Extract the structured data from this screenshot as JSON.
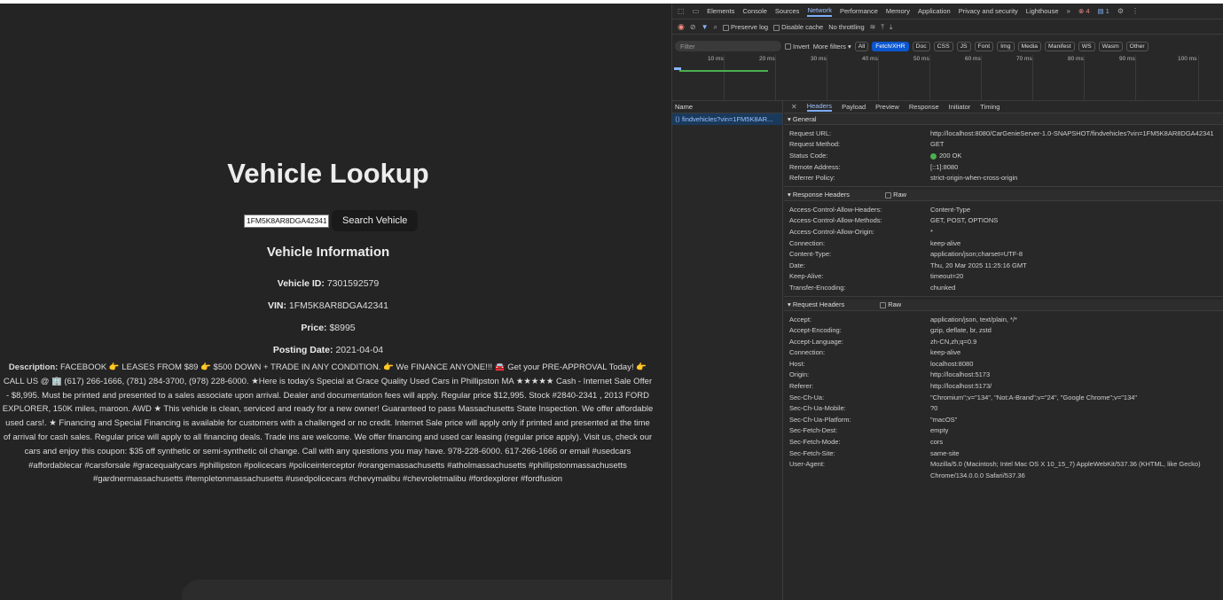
{
  "app": {
    "title": "Vehicle Lookup",
    "vin_input_value": "1FM5K8AR8DGA42341",
    "search_button": "Search Vehicle",
    "section_title": "Vehicle Information",
    "fields": [
      {
        "label": "Vehicle ID:",
        "value": "7301592579"
      },
      {
        "label": "VIN:",
        "value": "1FM5K8AR8DGA42341"
      },
      {
        "label": "Price:",
        "value": "$8995"
      },
      {
        "label": "Posting Date:",
        "value": "2021-04-04"
      }
    ],
    "description_label": "Description:",
    "description": "FACEBOOK 👉 LEASES FROM $89 👉 $500 DOWN + TRADE IN ANY CONDITION. 👉 We FINANCE ANYONE!!! 🚘 Get your PRE-APPROVAL Today! 👉CALL US @ 🏢 (617) 266-1666, (781) 284-3700, (978) 228-6000. ★Here is today's Special at Grace Quality Used Cars in Phillipston MA ★★★★★ Cash - Internet Sale Offer - $8,995. Must be printed and presented to a sales associate upon arrival. Dealer and documentation fees will apply. Regular price $12,995. Stock #2840-2341 , 2013 FORD EXPLORER, 150K miles, maroon. AWD ★ This vehicle is clean, serviced and ready for a new owner! Guaranteed to pass Massachusetts State Inspection. We offer affordable used cars!. ★ Financing and Special Financing is available for customers with a challenged or no credit. Internet Sale price will apply only if printed and presented at the time of arrival for cash sales. Regular price will apply to all financing deals. Trade ins are welcome. We offer financing and used car leasing (regular price apply). Visit us, check our cars and enjoy this coupon: $35 off synthetic or semi-synthetic oil change. Call with any questions you may have. 978-228-6000. 617-266-1666 or email #usedcars #affordablecar #carsforsale #gracequaitycars #phillipston #policecars #policeinterceptor #orangemassachusetts #atholmassachusetts #phillipstonmassachusetts #gardnermassachusetts #templetonmassachusetts #usedpolicecars #chevymalibu #chevroletmalibu #fordexplorer #fordfusion"
  },
  "devtools": {
    "tabs": [
      "Elements",
      "Console",
      "Sources",
      "Network",
      "Performance",
      "Memory",
      "Application",
      "Privacy and security",
      "Lighthouse"
    ],
    "more_tabs": "»",
    "error_count": "4",
    "info_count": "1",
    "toolbar": {
      "preserve_log": "Preserve log",
      "disable_cache": "Disable cache",
      "throttling": "No throttling"
    },
    "filter": {
      "placeholder": "Filter",
      "invert": "Invert",
      "more_filters": "More filters ▾",
      "chips": [
        "All",
        "Fetch/XHR",
        "Doc",
        "CSS",
        "JS",
        "Font",
        "Img",
        "Media",
        "Manifest",
        "WS",
        "Wasm",
        "Other"
      ]
    },
    "timeline_ticks": [
      "10 ms",
      "20 ms",
      "30 ms",
      "40 ms",
      "50 ms",
      "60 ms",
      "70 ms",
      "80 ms",
      "90 ms",
      "100 ms"
    ],
    "name_header": "Name",
    "request_name": "findvehicles?vin=1FM5K8AR...",
    "detail_tabs": [
      "Headers",
      "Payload",
      "Preview",
      "Response",
      "Initiator",
      "Timing"
    ],
    "general_title": "▾ General",
    "general": [
      {
        "k": "Request URL:",
        "v": "http://localhost:8080/CarGenieServer-1.0-SNAPSHOT/findvehicles?vin=1FM5K8AR8DGA42341"
      },
      {
        "k": "Request Method:",
        "v": "GET"
      },
      {
        "k": "Status Code:",
        "v": "200 OK"
      },
      {
        "k": "Remote Address:",
        "v": "[::1]:8080"
      },
      {
        "k": "Referrer Policy:",
        "v": "strict-origin-when-cross-origin"
      }
    ],
    "response_title": "▾ Response Headers",
    "raw_label": "Raw",
    "response": [
      {
        "k": "Access-Control-Allow-Headers:",
        "v": "Content-Type"
      },
      {
        "k": "Access-Control-Allow-Methods:",
        "v": "GET, POST, OPTIONS"
      },
      {
        "k": "Access-Control-Allow-Origin:",
        "v": "*"
      },
      {
        "k": "Connection:",
        "v": "keep-alive"
      },
      {
        "k": "Content-Type:",
        "v": "application/json;charset=UTF-8"
      },
      {
        "k": "Date:",
        "v": "Thu, 20 Mar 2025 11:25:16 GMT"
      },
      {
        "k": "Keep-Alive:",
        "v": "timeout=20"
      },
      {
        "k": "Transfer-Encoding:",
        "v": "chunked"
      }
    ],
    "request_title": "▾ Request Headers",
    "request": [
      {
        "k": "Accept:",
        "v": "application/json, text/plain, */*"
      },
      {
        "k": "Accept-Encoding:",
        "v": "gzip, deflate, br, zstd"
      },
      {
        "k": "Accept-Language:",
        "v": "zh-CN,zh;q=0.9"
      },
      {
        "k": "Connection:",
        "v": "keep-alive"
      },
      {
        "k": "Host:",
        "v": "localhost:8080"
      },
      {
        "k": "Origin:",
        "v": "http://localhost:5173"
      },
      {
        "k": "Referer:",
        "v": "http://localhost:5173/"
      },
      {
        "k": "Sec-Ch-Ua:",
        "v": "\"Chromium\";v=\"134\", \"Not:A-Brand\";v=\"24\", \"Google Chrome\";v=\"134\""
      },
      {
        "k": "Sec-Ch-Ua-Mobile:",
        "v": "?0"
      },
      {
        "k": "Sec-Ch-Ua-Platform:",
        "v": "\"macOS\""
      },
      {
        "k": "Sec-Fetch-Dest:",
        "v": "empty"
      },
      {
        "k": "Sec-Fetch-Mode:",
        "v": "cors"
      },
      {
        "k": "Sec-Fetch-Site:",
        "v": "same-site"
      },
      {
        "k": "User-Agent:",
        "v": "Mozilla/5.0 (Macintosh; Intel Mac OS X 10_15_7) AppleWebKit/537.36 (KHTML, like Gecko)"
      },
      {
        "k": "",
        "v": "Chrome/134.0.0.0 Safari/537.36"
      }
    ]
  }
}
